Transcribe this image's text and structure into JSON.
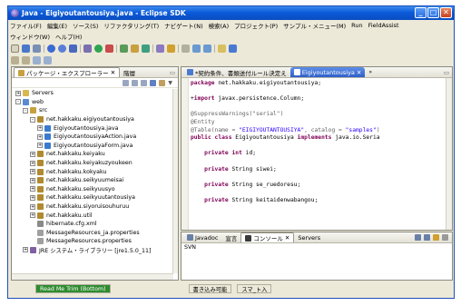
{
  "window": {
    "title": "Java - Eigiyoutantousiya.java - Eclipse SDK",
    "controls": [
      "_",
      "□",
      "✕"
    ]
  },
  "menubar": {
    "items": [
      "ファイル(F)",
      "編集(E)",
      "ソース(S)",
      "リファクタリング(T)",
      "ナビゲート(N)",
      "検索(A)",
      "プロジェクト(P)",
      "サンプル・メニュー(M)",
      "Run",
      "FieldAssist"
    ],
    "items2": [
      "ウィンドウ(W)",
      "ヘルプ(H)"
    ]
  },
  "explorer": {
    "tab_label": "パッケージ・エクスプローラー",
    "tab2_label": "階層",
    "tree": [
      {
        "label": "Servers",
        "indent": 0,
        "toggle": "+",
        "icon": "folder-icon"
      },
      {
        "label": "web",
        "indent": 0,
        "toggle": "-",
        "icon": "project-icon"
      },
      {
        "label": "src",
        "indent": 1,
        "toggle": "-",
        "icon": "source-folder-icon"
      },
      {
        "label": "net.hakkaku.eigiyoutantousiya",
        "indent": 2,
        "toggle": "-",
        "icon": "package-icon"
      },
      {
        "label": "Eigiyoutantousiya.java",
        "indent": 3,
        "toggle": "+",
        "icon": "java-file-icon"
      },
      {
        "label": "EigiyoutantousiyaAction.java",
        "indent": 3,
        "toggle": "+",
        "icon": "java-file-icon"
      },
      {
        "label": "EigiyoutantousiyaForm.java",
        "indent": 3,
        "toggle": "+",
        "icon": "java-file-icon"
      },
      {
        "label": "net.hakkaku.keiyaku",
        "indent": 2,
        "toggle": "+",
        "icon": "package-icon"
      },
      {
        "label": "net.hakkaku.keiyakuzyoukeen",
        "indent": 2,
        "toggle": "+",
        "icon": "package-icon"
      },
      {
        "label": "net.hakkaku.kokyaku",
        "indent": 2,
        "toggle": "+",
        "icon": "package-icon"
      },
      {
        "label": "net.hakkaku.seikyuumeisai",
        "indent": 2,
        "toggle": "+",
        "icon": "package-icon"
      },
      {
        "label": "net.hakkaku.seikyuusyo",
        "indent": 2,
        "toggle": "+",
        "icon": "package-icon"
      },
      {
        "label": "net.hakkaku.seikyuutantousiya",
        "indent": 2,
        "toggle": "+",
        "icon": "package-icon"
      },
      {
        "label": "net.hakkaku.siyoruisouhuruu",
        "indent": 2,
        "toggle": "+",
        "icon": "package-icon"
      },
      {
        "label": "net.hakkaku.util",
        "indent": 2,
        "toggle": "+",
        "icon": "package-icon"
      },
      {
        "label": "hibernate.cfg.xml",
        "indent": 2,
        "toggle": "",
        "icon": "xml-file-icon"
      },
      {
        "label": "MessageResources_ja.properties",
        "indent": 2,
        "toggle": "",
        "icon": "properties-file-icon"
      },
      {
        "label": "MessageResources.properties",
        "indent": 2,
        "toggle": "",
        "icon": "properties-file-icon"
      },
      {
        "label": "JRE システム・ライブラリー [jre1.5.0_11]",
        "indent": 1,
        "toggle": "+",
        "icon": "library-icon"
      }
    ]
  },
  "editor": {
    "tab1_label": "*契約条件、書類送付ルール決定え",
    "tab2_label": "Eigiyoutantousiya",
    "code_lines": [
      {
        "parts": [
          {
            "t": "package ",
            "c": "kw"
          },
          {
            "t": "net.hakkaku.eigiyoutantousiya;",
            "c": ""
          }
        ]
      },
      {
        "parts": []
      },
      {
        "parts": [
          {
            "t": "+",
            "c": ""
          },
          {
            "t": "import ",
            "c": "kw"
          },
          {
            "t": "javax.persistence.Column;",
            "c": ""
          }
        ]
      },
      {
        "parts": []
      },
      {
        "parts": [
          {
            "t": "@SuppressWarnings(\"serial\")",
            "c": "ann"
          }
        ]
      },
      {
        "parts": [
          {
            "t": "@Entity",
            "c": "ann"
          }
        ]
      },
      {
        "parts": [
          {
            "t": "@Table(name = ",
            "c": "ann"
          },
          {
            "t": "\"EIGIYOUTANTOUSIYA\"",
            "c": "str"
          },
          {
            "t": ", catalog = ",
            "c": "ann"
          },
          {
            "t": "\"samples\"",
            "c": "str"
          },
          {
            "t": ")",
            "c": "ann"
          }
        ]
      },
      {
        "parts": [
          {
            "t": "public class ",
            "c": "kw"
          },
          {
            "t": "Eigiyoutantousiya ",
            "c": ""
          },
          {
            "t": "implements ",
            "c": "kw"
          },
          {
            "t": "java.io.Seria",
            "c": ""
          }
        ]
      },
      {
        "parts": []
      },
      {
        "parts": [
          {
            "t": "    private int ",
            "c": "kw"
          },
          {
            "t": "id;",
            "c": ""
          }
        ]
      },
      {
        "parts": []
      },
      {
        "parts": [
          {
            "t": "    private ",
            "c": "kw"
          },
          {
            "t": "String siwei;",
            "c": ""
          }
        ]
      },
      {
        "parts": []
      },
      {
        "parts": [
          {
            "t": "    private ",
            "c": "kw"
          },
          {
            "t": "String se_ruedoresu;",
            "c": ""
          }
        ]
      },
      {
        "parts": []
      },
      {
        "parts": [
          {
            "t": "    private ",
            "c": "kw"
          },
          {
            "t": "String keitaidenwabangou;",
            "c": ""
          }
        ]
      }
    ]
  },
  "console": {
    "tabs": [
      "Javadoc",
      "宣言",
      "コンソール",
      "Servers"
    ],
    "content": "SVN"
  },
  "statusbar": {
    "left": "Read Me Trim (Bottom)",
    "writable": "書き込み可能",
    "insert_mode": "スマ_ト入"
  },
  "colors": {
    "titlebar": "#0b5bd9",
    "keyword": "#7f0055",
    "string": "#2a00ff",
    "annotation": "#646464",
    "status_badge": "#2e8b2e"
  }
}
